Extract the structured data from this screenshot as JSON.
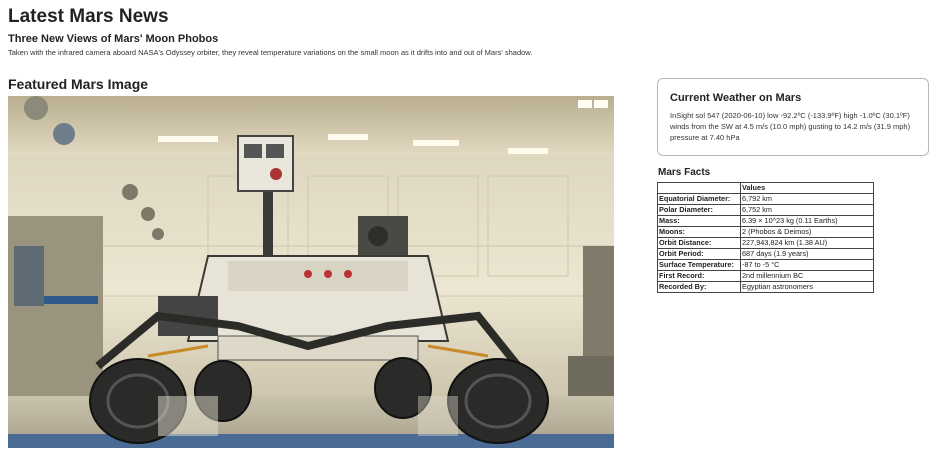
{
  "page": {
    "title": "Latest Mars News"
  },
  "news": {
    "title": "Three New Views of Mars' Moon Phobos",
    "teaser": "Taken with the infrared camera aboard NASA's Odyssey orbiter, they reveal temperature variations on the small moon as it drifts into and out of Mars' shadow."
  },
  "featured": {
    "heading": "Featured Mars Image"
  },
  "weather": {
    "title": "Current Weather on Mars",
    "text": "InSight sol 547 (2020-06-10) low -92.2ºC (-133.9ºF) high -1.0ºC (30.1ºF) winds from the SW at 4.5 m/s (10.0 mph) gusting to 14.2 m/s (31.9 mph) pressure at 7.40 hPa"
  },
  "facts": {
    "heading": "Mars Facts",
    "columns": [
      "",
      "Values"
    ],
    "rows": [
      {
        "label": "Equatorial Diameter:",
        "value": "6,792 km"
      },
      {
        "label": "Polar Diameter:",
        "value": "6,752 km"
      },
      {
        "label": "Mass:",
        "value": "6.39 × 10^23 kg (0.11 Earths)"
      },
      {
        "label": "Moons:",
        "value": "2 (Phobos & Deimos)"
      },
      {
        "label": "Orbit Distance:",
        "value": "227,943,824 km (1.38 AU)"
      },
      {
        "label": "Orbit Period:",
        "value": "687 days (1.9 years)"
      },
      {
        "label": "Surface Temperature:",
        "value": "-87 to -5 °C"
      },
      {
        "label": "First Record:",
        "value": "2nd millennium BC"
      },
      {
        "label": "Recorded By:",
        "value": "Egyptian astronomers"
      }
    ]
  }
}
